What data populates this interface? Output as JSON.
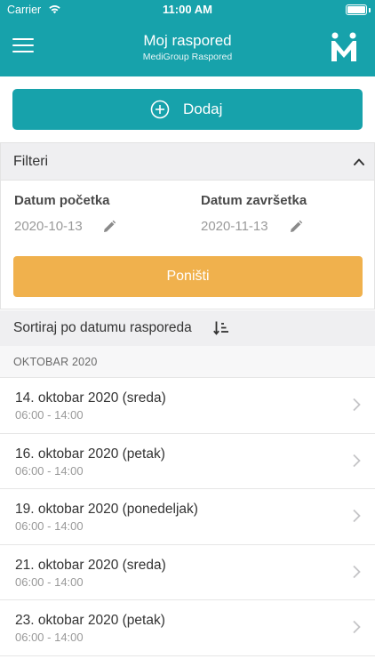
{
  "status_bar": {
    "carrier": "Carrier",
    "time": "11:00 AM"
  },
  "nav": {
    "title": "Moj raspored",
    "subtitle": "MediGroup Raspored",
    "color": "#17a2ab"
  },
  "add_button": {
    "label": "Dodaj"
  },
  "filters": {
    "title": "Filteri",
    "start_label": "Datum početka",
    "start_value": "2020-10-13",
    "end_label": "Datum završetka",
    "end_value": "2020-11-13",
    "reset_label": "Poništi",
    "reset_color": "#f0b14d"
  },
  "sort": {
    "label": "Sortiraj po datumu rasporeda"
  },
  "month": {
    "label": "OKTOBAR 2020"
  },
  "schedule": [
    {
      "date": "14. oktobar 2020 (sreda)",
      "hours": "06:00 - 14:00"
    },
    {
      "date": "16. oktobar 2020 (petak)",
      "hours": "06:00 - 14:00"
    },
    {
      "date": "19. oktobar 2020 (ponedeljak)",
      "hours": "06:00 - 14:00"
    },
    {
      "date": "21. oktobar 2020 (sreda)",
      "hours": "06:00 - 14:00"
    },
    {
      "date": "23. oktobar 2020 (petak)",
      "hours": "06:00 - 14:00"
    }
  ]
}
